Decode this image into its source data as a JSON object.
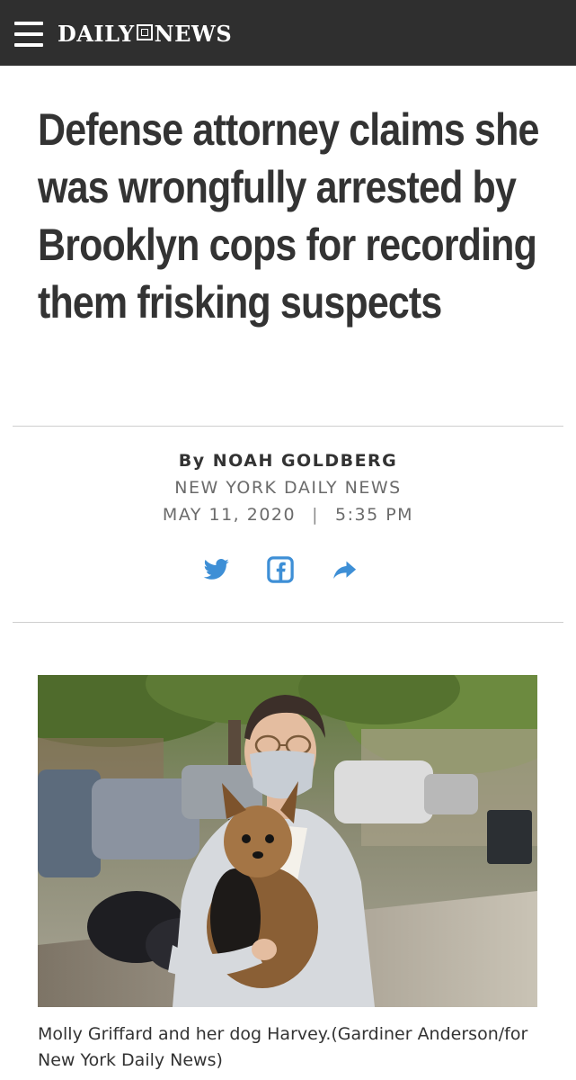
{
  "header": {
    "menu_icon": "hamburger-menu-icon",
    "logo_left": "DAILY",
    "logo_right": "NEWS",
    "background": "#2f2f2f"
  },
  "article": {
    "headline": "Defense attorney claims she was wrongfully arrested by Brooklyn cops for recording them frisking suspects",
    "byline": "By NOAH GOLDBERG",
    "source": "NEW YORK DAILY NEWS",
    "date": "MAY 11, 2020",
    "separator": "|",
    "time": "5:35 PM"
  },
  "share": {
    "icons": [
      "twitter-icon",
      "facebook-icon",
      "share-forward-icon"
    ],
    "color": "#3e8fd6"
  },
  "photo": {
    "caption": "Molly Griffard and her dog Harvey.(Gardiner Anderson/for New York Daily News)"
  }
}
